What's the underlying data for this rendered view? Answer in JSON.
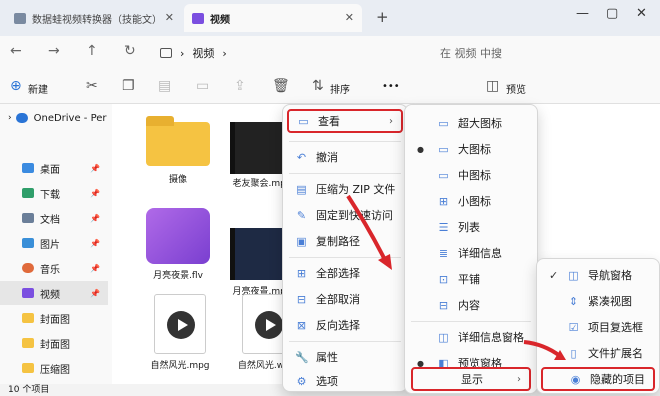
{
  "tabs": [
    {
      "label": "数据蛙视频转换器（技能文）"
    },
    {
      "label": "视频"
    }
  ],
  "address": {
    "crumb": "视频",
    "search_placeholder": "在 视频 中搜"
  },
  "toolbar": {
    "new": "新建",
    "sort": "排序",
    "preview": "预览",
    "more": "•••"
  },
  "nav": {
    "items": [
      {
        "label": "OneDrive - Per"
      },
      {
        "label": "桌面"
      },
      {
        "label": "下载"
      },
      {
        "label": "文档"
      },
      {
        "label": "图片"
      },
      {
        "label": "音乐"
      },
      {
        "label": "视频"
      },
      {
        "label": "封面图"
      },
      {
        "label": "封面图"
      },
      {
        "label": "压缩图"
      }
    ]
  },
  "files": [
    {
      "name": "摄像",
      "type": "folder"
    },
    {
      "name": "老友聚会.mp4",
      "type": "video"
    },
    {
      "name": "月亮夜景.flv",
      "type": "clap"
    },
    {
      "name": "月亮夜景.mp4",
      "type": "video"
    },
    {
      "name": "自然风光.mpg",
      "type": "media"
    },
    {
      "name": "自然风光.wmv",
      "type": "media"
    }
  ],
  "status": "10 个项目",
  "context_menu": {
    "items": [
      "查看",
      "撤消",
      "压缩为 ZIP 文件",
      "固定到快速访问",
      "复制路径",
      "全部选择",
      "全部取消",
      "反向选择",
      "属性",
      "选项"
    ]
  },
  "view_menu": {
    "items": [
      "超大图标",
      "大图标",
      "中图标",
      "小图标",
      "列表",
      "详细信息",
      "平铺",
      "内容",
      "详细信息窗格",
      "预览窗格",
      "显示"
    ]
  },
  "show_menu": {
    "items": [
      "导航窗格",
      "紧凑视图",
      "项目复选框",
      "文件扩展名",
      "隐藏的项目"
    ]
  },
  "colors": {
    "highlight": "#d9262b",
    "accent": "#4a7fd6"
  }
}
